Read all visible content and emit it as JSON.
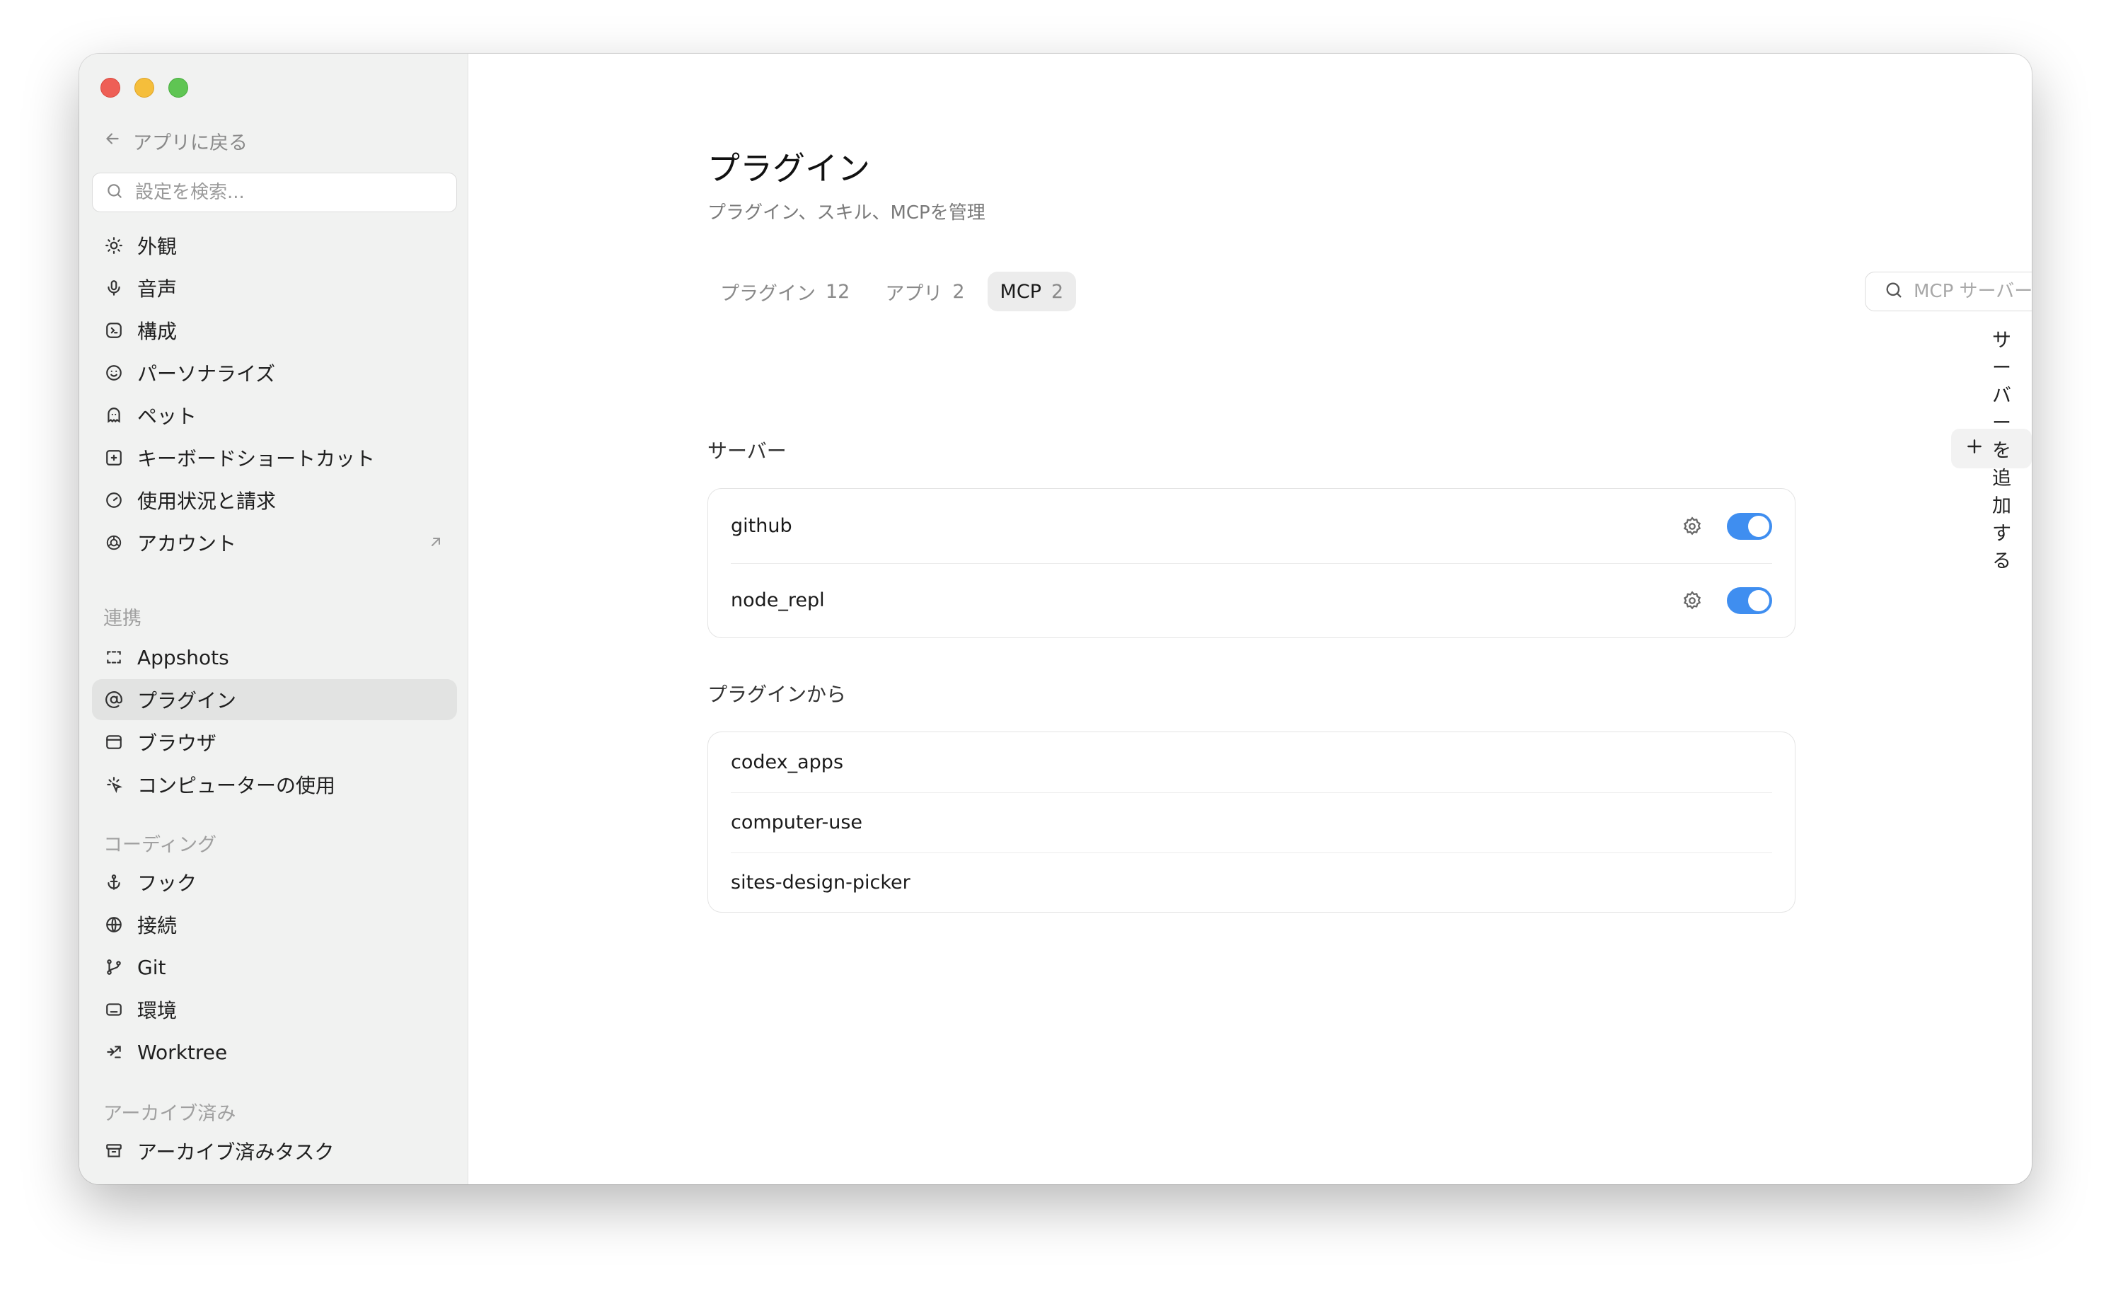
{
  "sidebar": {
    "back_label": "アプリに戻る",
    "search_placeholder": "設定を検索...",
    "general_items": [
      {
        "label": "外観",
        "icon": "sun-icon"
      },
      {
        "label": "音声",
        "icon": "microphone-icon"
      },
      {
        "label": "構成",
        "icon": "config-icon"
      },
      {
        "label": "パーソナライズ",
        "icon": "personalize-icon"
      },
      {
        "label": "ペット",
        "icon": "pet-icon"
      },
      {
        "label": "キーボードショートカット",
        "icon": "keyboard-icon"
      },
      {
        "label": "使用状況と請求",
        "icon": "gauge-icon"
      },
      {
        "label": "アカウント",
        "icon": "openai-icon"
      }
    ],
    "integrations_title": "連携",
    "integration_items": [
      {
        "label": "Appshots",
        "icon": "screenshot-icon"
      },
      {
        "label": "プラグイン",
        "icon": "at-icon"
      },
      {
        "label": "ブラウザ",
        "icon": "browser-icon"
      },
      {
        "label": "コンピューターの使用",
        "icon": "cursor-sparkle-icon"
      }
    ],
    "coding_title": "コーディング",
    "coding_items": [
      {
        "label": "フック",
        "icon": "anchor-icon"
      },
      {
        "label": "接続",
        "icon": "globe-icon"
      },
      {
        "label": "Git",
        "icon": "git-branch-icon"
      },
      {
        "label": "環境",
        "icon": "terminal-icon"
      },
      {
        "label": "Worktree",
        "icon": "worktree-icon"
      }
    ],
    "archived_title": "アーカイブ済み",
    "archived_items": [
      {
        "label": "アーカイブ済みタスク",
        "icon": "archive-icon"
      }
    ]
  },
  "main": {
    "title": "プラグイン",
    "subtitle": "プラグイン、スキル、MCPを管理",
    "tabs": [
      {
        "label": "プラグイン",
        "count": "12"
      },
      {
        "label": "アプリ",
        "count": "2"
      },
      {
        "label": "MCP",
        "count": "2"
      }
    ],
    "search_placeholder": "MCP サーバーを検索",
    "servers_label": "サーバー",
    "add_server_label": "サーバーを追加する",
    "servers": [
      {
        "name": "github",
        "enabled": true
      },
      {
        "name": "node_repl",
        "enabled": true
      }
    ],
    "from_plugins_label": "プラグインから",
    "plugin_servers": [
      {
        "name": "codex_apps"
      },
      {
        "name": "computer-use"
      },
      {
        "name": "sites-design-picker"
      }
    ]
  },
  "colors": {
    "accent": "#3f8ef0",
    "sidebar_bg": "#f1f2f1",
    "active_item_bg": "#e2e3e2"
  }
}
